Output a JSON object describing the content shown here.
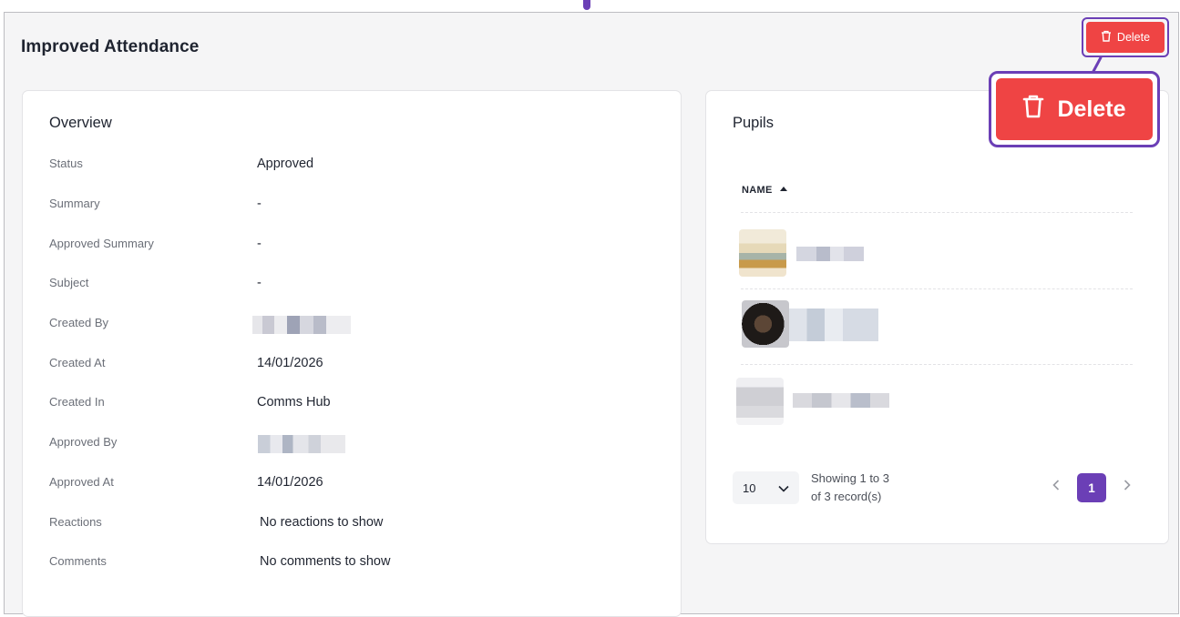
{
  "page": {
    "title": "Improved Attendance"
  },
  "actions": {
    "delete_label": "Delete",
    "delete_callout_label": "Delete"
  },
  "overview": {
    "title": "Overview",
    "rows": [
      {
        "label": "Status",
        "value": "Approved"
      },
      {
        "label": "Summary",
        "value": "-"
      },
      {
        "label": "Approved Summary",
        "value": "-"
      },
      {
        "label": "Subject",
        "value": "-"
      },
      {
        "label": "Created By",
        "value": ""
      },
      {
        "label": "Created At",
        "value": "14/01/2026"
      },
      {
        "label": "Created In",
        "value": "Comms Hub"
      },
      {
        "label": "Approved By",
        "value": ""
      },
      {
        "label": "Approved At",
        "value": "14/01/2026"
      },
      {
        "label": "Reactions",
        "value": "No reactions to show"
      },
      {
        "label": "Comments",
        "value": "No comments to show"
      }
    ]
  },
  "pupils": {
    "title": "Pupils",
    "column_header": "NAME",
    "sort": "ascending",
    "rows": [
      {
        "name": ""
      },
      {
        "name": ""
      },
      {
        "name": ""
      }
    ],
    "pagination": {
      "per_page": "10",
      "showing_line1": "Showing 1 to 3",
      "showing_line2": "of 3 record(s)",
      "current_page": "1"
    }
  },
  "colors": {
    "accent": "#6b3fb6",
    "danger": "#ef4444",
    "background": "#f5f5f6"
  },
  "icons": {
    "delete": "trash-icon",
    "dropdown": "chevron-down-icon",
    "prev": "chevron-left-icon",
    "next": "chevron-right-icon"
  }
}
